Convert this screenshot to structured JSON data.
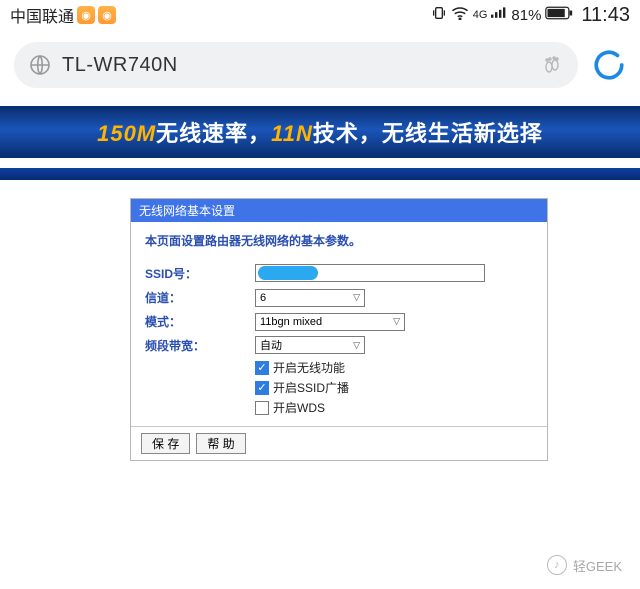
{
  "status": {
    "carrier": "中国联通",
    "network": "4G",
    "battery": "81%",
    "time": "11:43"
  },
  "url_bar": {
    "title": "TL-WR740N"
  },
  "banner": {
    "accent1": "150M",
    "t1": "无线速率，",
    "accent2": "11N",
    "t2": "技术，无线生活新选择"
  },
  "panel": {
    "title": "无线网络基本设置",
    "intro": "本页面设置路由器无线网络的基本参数。",
    "fields": {
      "ssid_label": "SSID号：",
      "ssid_value": "",
      "channel_label": "信道：",
      "channel_value": "6",
      "mode_label": "模式：",
      "mode_value": "11bgn mixed",
      "bandwidth_label": "频段带宽：",
      "bandwidth_value": "自动"
    },
    "checkboxes": {
      "wireless_enable": "开启无线功能",
      "ssid_broadcast": "开启SSID广播",
      "wds": "开启WDS"
    },
    "buttons": {
      "save": "保 存",
      "help": "帮 助"
    }
  },
  "watermark": "轻GEEK"
}
